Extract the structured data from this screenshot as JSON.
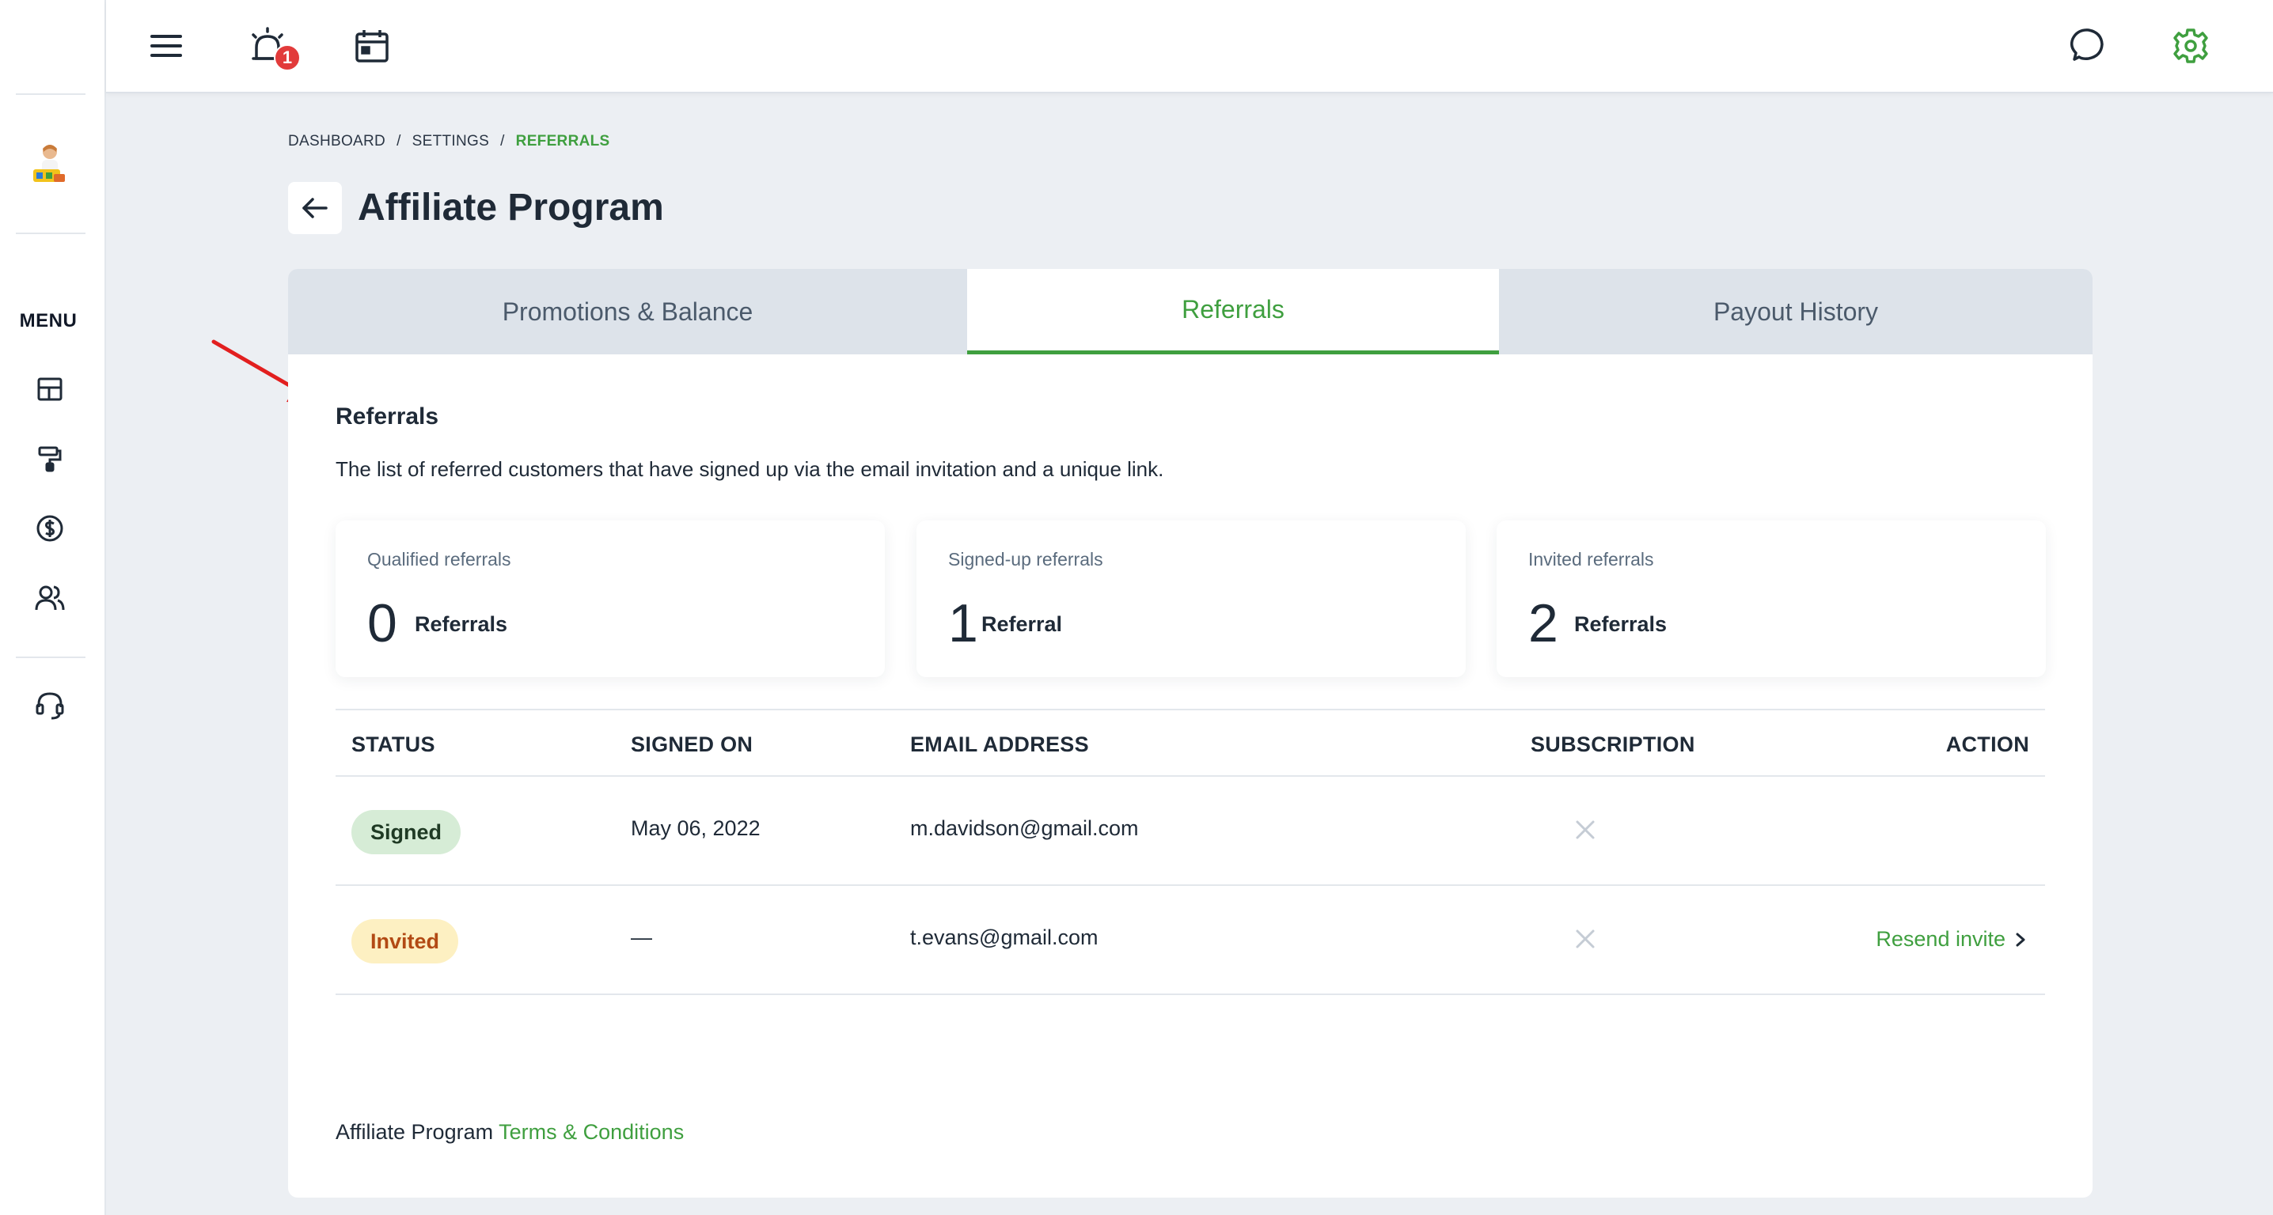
{
  "topbar": {
    "notification_count": "1"
  },
  "sidebar": {
    "menu_label": "MENU"
  },
  "breadcrumb": {
    "items": [
      "DASHBOARD",
      "SETTINGS",
      "REFERRALS"
    ],
    "separator": "/"
  },
  "page": {
    "title": "Affiliate Program"
  },
  "tabs": [
    {
      "label": "Promotions & Balance",
      "active": false
    },
    {
      "label": "Referrals",
      "active": true
    },
    {
      "label": "Payout History",
      "active": false
    }
  ],
  "section": {
    "title": "Referrals",
    "description": "The list of referred customers that have signed up via the email invitation and a unique link."
  },
  "stats": [
    {
      "label": "Qualified referrals",
      "value": "0",
      "unit": "Referrals"
    },
    {
      "label": "Signed-up referrals",
      "value": "1",
      "unit": "Referral"
    },
    {
      "label": "Invited referrals",
      "value": "2",
      "unit": "Referrals"
    }
  ],
  "table": {
    "headers": [
      "STATUS",
      "SIGNED ON",
      "EMAIL ADDRESS",
      "SUBSCRIPTION",
      "ACTION"
    ],
    "rows": [
      {
        "status": "Signed",
        "signed_on": "May 06, 2022",
        "email": "m.davidson@gmail.com",
        "subscription": "none",
        "action": ""
      },
      {
        "status": "Invited",
        "signed_on": "—",
        "email": "t.evans@gmail.com",
        "subscription": "none",
        "action": "Resend invite"
      }
    ]
  },
  "footer": {
    "prefix": "Affiliate Program",
    "link": "Terms & Conditions"
  },
  "colors": {
    "accent": "#3f9f3f",
    "badge": "#e23b3b",
    "annotation_arrow": "#e21f1f"
  }
}
